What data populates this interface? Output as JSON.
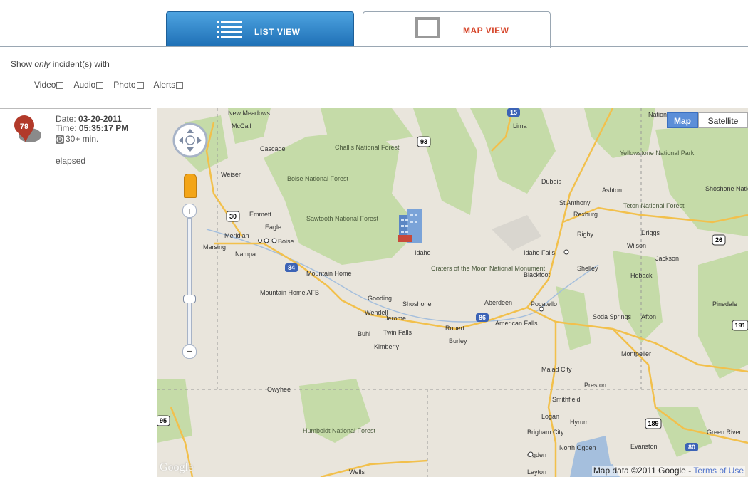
{
  "tabs": {
    "list_label": "LIST VIEW",
    "map_label": "MAP VIEW"
  },
  "filter": {
    "title_prefix": "Show ",
    "title_emph": "only",
    "title_suffix": " incident(s) with",
    "options": [
      {
        "label": "Video"
      },
      {
        "label": "Audio"
      },
      {
        "label": "Photo"
      },
      {
        "label": "Alerts"
      }
    ]
  },
  "incident": {
    "badge": "79",
    "date_label": "Date: ",
    "date_value": "03-20-2011",
    "time_label": "Time: ",
    "time_value": "05:35:17 PM",
    "elapsed_line1": "30+ min.",
    "elapsed_line2": "elapsed"
  },
  "map": {
    "map_button": "Map",
    "satellite_button": "Satellite",
    "attribution": "Map data ©2011 Google - ",
    "terms": "Terms of Use",
    "logo": "Google",
    "labels": {
      "idaho": "Idaho",
      "boise": "Boise",
      "nampa": "Nampa",
      "meridian": "Meridian",
      "eagle": "Eagle",
      "emmett": "Emmett",
      "marsing": "Marsing",
      "weiser": "Weiser",
      "cascade": "Cascade",
      "mccall": "McCall",
      "new_meadows": "New Meadows",
      "challis_nf": "Challis National Forest",
      "challis": "Challis",
      "boise_nf": "Boise National Forest",
      "sawtooth_nf": "Sawtooth National Forest",
      "mountain_home": "Mountain Home",
      "mountain_home_afb": "Mountain Home AFB",
      "craters": "Craters of the Moon National Monument",
      "idaho_falls": "Idaho Falls",
      "pocatello": "Pocatello",
      "blackfoot": "Blackfoot",
      "shelley": "Shelley",
      "rexburg": "Rexburg",
      "rigby": "Rigby",
      "st_anthony": "St Anthony",
      "ashton": "Ashton",
      "driggs": "Driggs",
      "wilson": "Wilson",
      "jackson": "Jackson",
      "hoback": "Hoback",
      "dubois": "Dubois",
      "salmon": "Lima",
      "yellowstone": "Yellowstone National Park",
      "teton_nf": "Teton National Forest",
      "twin_falls": "Twin Falls",
      "jerome": "Jerome",
      "wendell": "Wendell",
      "gooding": "Gooding",
      "shoshone": "Shoshone",
      "buhl": "Buhl",
      "kimberly": "Kimberly",
      "rupert": "Rupert",
      "burley": "Burley",
      "american_falls": "American Falls",
      "aberdeen": "Aberdeen",
      "soda_springs": "Soda Springs",
      "afton": "Afton",
      "montpelier": "Montpelier",
      "malad": "Malad City",
      "preston": "Preston",
      "smithfield": "Smithfield",
      "logan": "Logan",
      "hyrum": "Hyrum",
      "brigham": "Brigham City",
      "ogden": "Ogden",
      "north_ogden": "North Ogden",
      "evanston": "Evanston",
      "green_river": "Green River",
      "pinedale": "Pinedale",
      "owyhee": "Owyhee",
      "humboldt_nf": "Humboldt National Forest",
      "wells": "Wells",
      "layton": "Layton",
      "nation": "Nation",
      "shoshone_nf": "Shoshone National"
    },
    "shields": [
      "15",
      "93",
      "95",
      "30",
      "84",
      "26",
      "86",
      "191",
      "189",
      "80"
    ]
  },
  "colors": {
    "accent_blue": "#2b7dc4",
    "map_tab_text": "#d6452a",
    "forest": "#c5dba8",
    "road": "#f2c04c"
  }
}
